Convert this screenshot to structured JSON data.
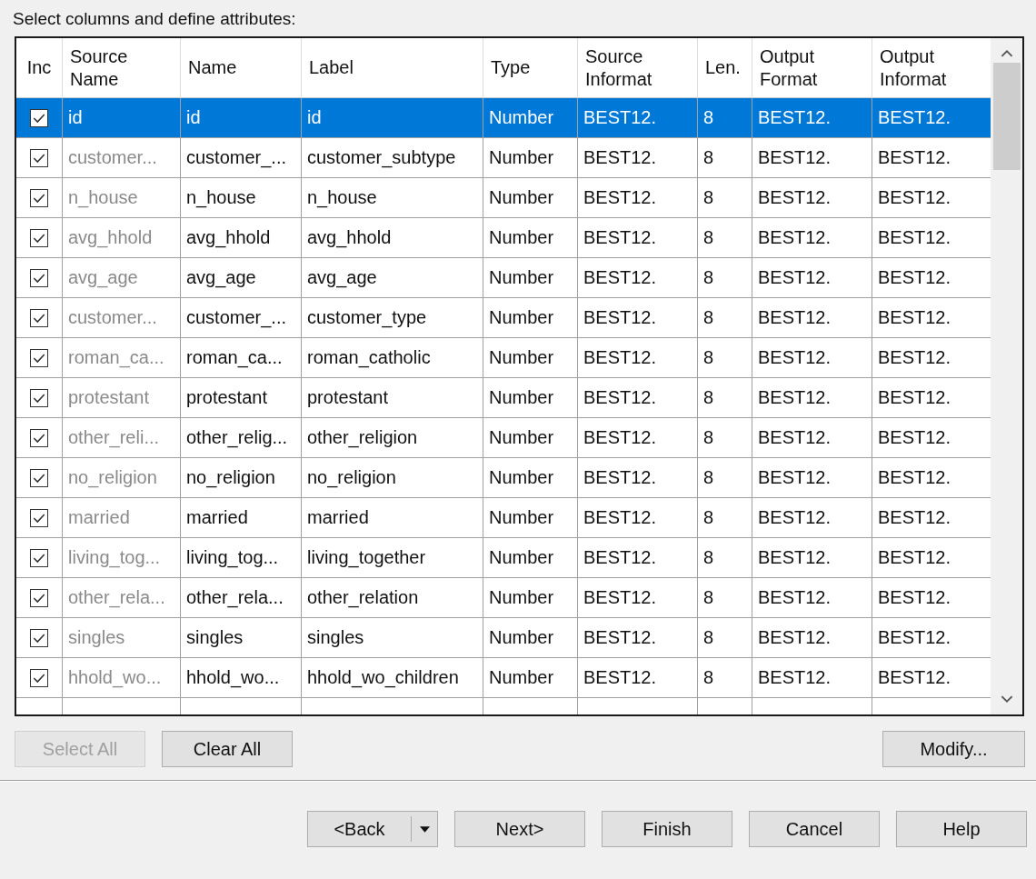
{
  "instruction": "Select columns and define attributes:",
  "table": {
    "include_header": "Inc",
    "columns": [
      {
        "label": "Source Name",
        "dimmed": true
      },
      {
        "label": "Name",
        "dimmed": false
      },
      {
        "label": "Label",
        "dimmed": false
      },
      {
        "label": "Type",
        "dimmed": false
      },
      {
        "label": "Source Informat",
        "dimmed": false
      },
      {
        "label": "Len.",
        "dimmed": false
      },
      {
        "label": "Output Format",
        "dimmed": false
      },
      {
        "label": "Output Informat",
        "dimmed": false
      }
    ],
    "rows": [
      {
        "included": true,
        "selected": true,
        "cells": [
          "id",
          "id",
          "id",
          "Number",
          "BEST12.",
          "8",
          "BEST12.",
          "BEST12."
        ]
      },
      {
        "included": true,
        "selected": false,
        "cells": [
          "customer...",
          "customer_...",
          "customer_subtype",
          "Number",
          "BEST12.",
          "8",
          "BEST12.",
          "BEST12."
        ]
      },
      {
        "included": true,
        "selected": false,
        "cells": [
          "n_house",
          "n_house",
          "n_house",
          "Number",
          "BEST12.",
          "8",
          "BEST12.",
          "BEST12."
        ]
      },
      {
        "included": true,
        "selected": false,
        "cells": [
          "avg_hhold",
          "avg_hhold",
          "avg_hhold",
          "Number",
          "BEST12.",
          "8",
          "BEST12.",
          "BEST12."
        ]
      },
      {
        "included": true,
        "selected": false,
        "cells": [
          "avg_age",
          "avg_age",
          "avg_age",
          "Number",
          "BEST12.",
          "8",
          "BEST12.",
          "BEST12."
        ]
      },
      {
        "included": true,
        "selected": false,
        "cells": [
          "customer...",
          "customer_...",
          "customer_type",
          "Number",
          "BEST12.",
          "8",
          "BEST12.",
          "BEST12."
        ]
      },
      {
        "included": true,
        "selected": false,
        "cells": [
          "roman_ca...",
          "roman_ca...",
          "roman_catholic",
          "Number",
          "BEST12.",
          "8",
          "BEST12.",
          "BEST12."
        ]
      },
      {
        "included": true,
        "selected": false,
        "cells": [
          "protestant",
          "protestant",
          "protestant",
          "Number",
          "BEST12.",
          "8",
          "BEST12.",
          "BEST12."
        ]
      },
      {
        "included": true,
        "selected": false,
        "cells": [
          "other_reli...",
          "other_relig...",
          "other_religion",
          "Number",
          "BEST12.",
          "8",
          "BEST12.",
          "BEST12."
        ]
      },
      {
        "included": true,
        "selected": false,
        "cells": [
          "no_religion",
          "no_religion",
          "no_religion",
          "Number",
          "BEST12.",
          "8",
          "BEST12.",
          "BEST12."
        ]
      },
      {
        "included": true,
        "selected": false,
        "cells": [
          "married",
          "married",
          "married",
          "Number",
          "BEST12.",
          "8",
          "BEST12.",
          "BEST12."
        ]
      },
      {
        "included": true,
        "selected": false,
        "cells": [
          "living_tog...",
          "living_tog...",
          "living_together",
          "Number",
          "BEST12.",
          "8",
          "BEST12.",
          "BEST12."
        ]
      },
      {
        "included": true,
        "selected": false,
        "cells": [
          "other_rela...",
          "other_rela...",
          "other_relation",
          "Number",
          "BEST12.",
          "8",
          "BEST12.",
          "BEST12."
        ]
      },
      {
        "included": true,
        "selected": false,
        "cells": [
          "singles",
          "singles",
          "singles",
          "Number",
          "BEST12.",
          "8",
          "BEST12.",
          "BEST12."
        ]
      },
      {
        "included": true,
        "selected": false,
        "cells": [
          "hhold_wo...",
          "hhold_wo...",
          "hhold_wo_children",
          "Number",
          "BEST12.",
          "8",
          "BEST12.",
          "BEST12."
        ]
      }
    ]
  },
  "left_buttons": [
    {
      "label": "Select All",
      "disabled": true
    },
    {
      "label": "Clear All",
      "disabled": false
    }
  ],
  "modify_button": {
    "label": "Modify...",
    "disabled": false
  },
  "wizard_buttons": [
    {
      "label": "<Back",
      "dropdown": true
    },
    {
      "label": "Next>",
      "dropdown": false
    },
    {
      "label": "Finish",
      "dropdown": false
    },
    {
      "label": "Cancel",
      "dropdown": false
    },
    {
      "label": "Help",
      "dropdown": false
    }
  ]
}
